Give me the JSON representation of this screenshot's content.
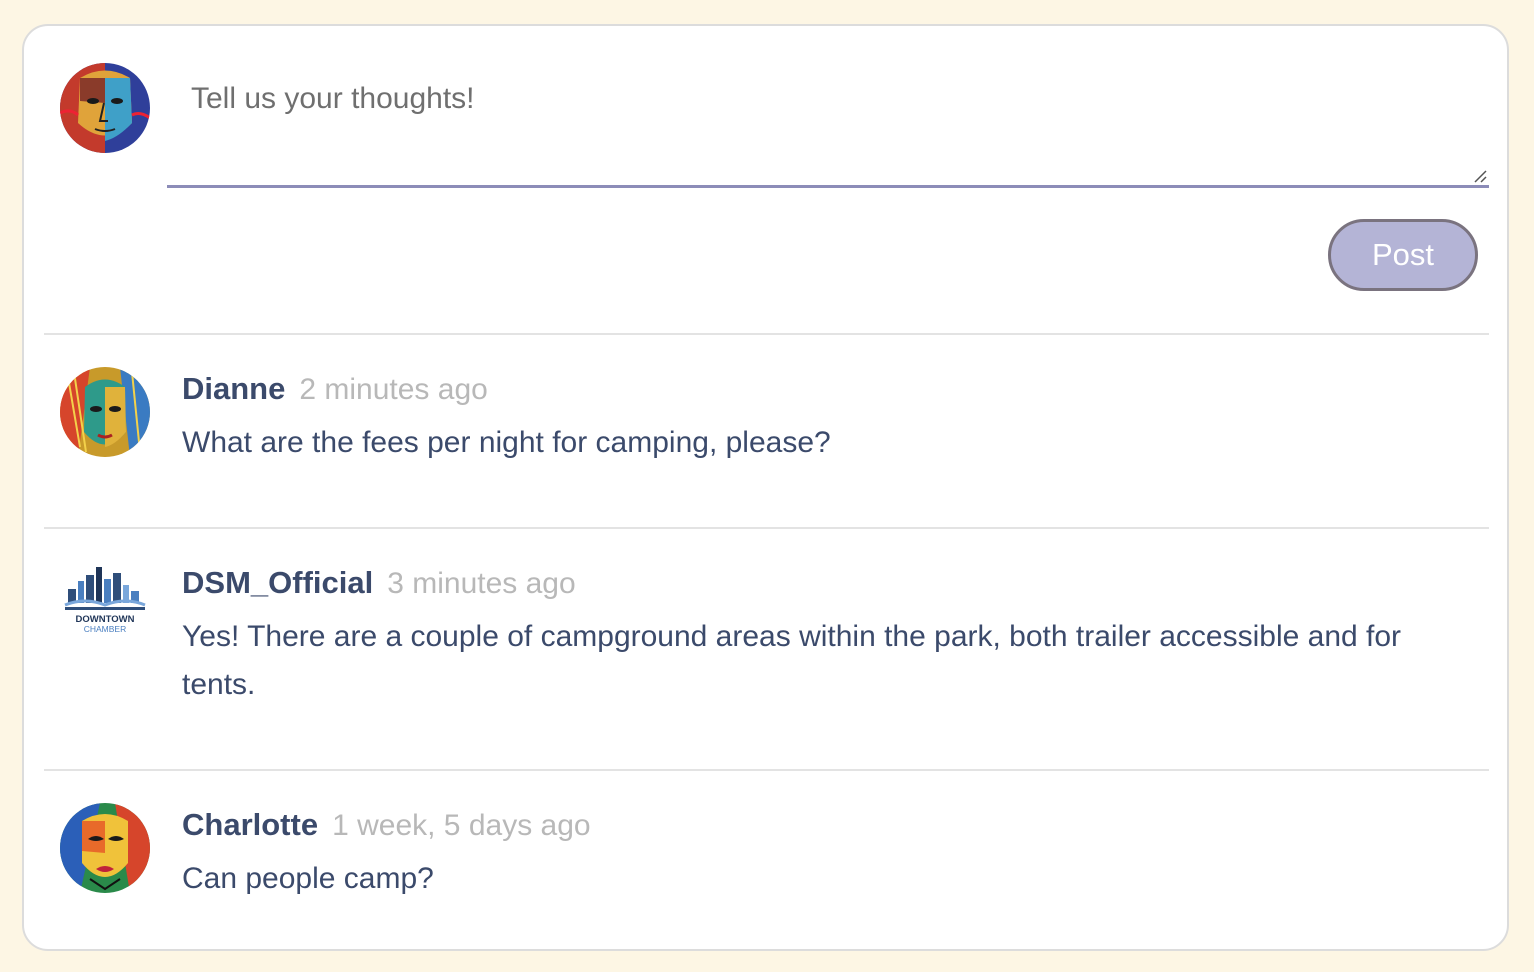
{
  "composer": {
    "placeholder": "Tell us your thoughts!",
    "post_label": "Post"
  },
  "comments": [
    {
      "author": "Dianne",
      "time": "2 minutes ago",
      "text": "What are the fees per night for camping, please?"
    },
    {
      "author": "DSM_Official",
      "time": "3 minutes ago",
      "text": "Yes! There are a couple of campground areas within the park, both trailer accessible and for tents."
    },
    {
      "author": "Charlotte",
      "time": "1 week, 5 days ago",
      "text": "Can people camp?"
    }
  ],
  "logo": {
    "line1": "DOWNTOWN",
    "line2": "CHAMBER"
  },
  "colors": {
    "page_background": "#fdf6e4",
    "author_text": "#3b4a6b",
    "timestamp_text": "#b8b8b8",
    "post_button_fill": "#b4b4d6",
    "input_underline": "#8c8cb8"
  }
}
